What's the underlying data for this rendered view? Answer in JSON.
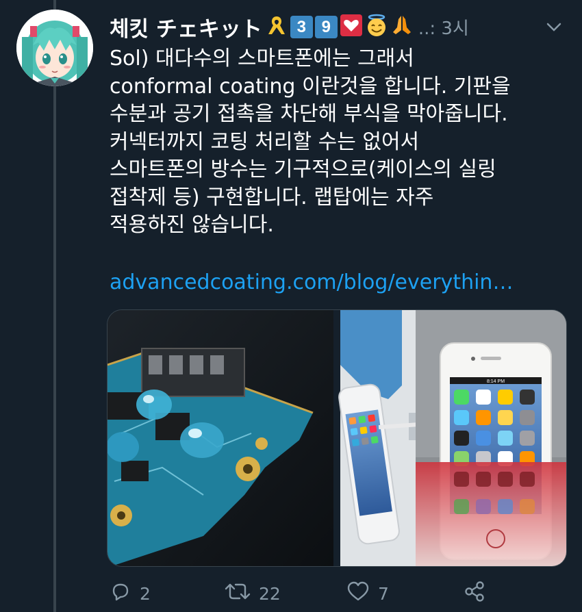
{
  "tweet": {
    "display_name": "체킷 チェキット",
    "badges": [
      "3",
      "9"
    ],
    "meta": "..: 3시",
    "body_lines": [
      "Sol) 대다수의 스마트폰에는 그래서",
      "conformal coating 이란것을 합니다. 기판을",
      "수분과 공기 접촉을 차단해 부식을 막아줍니다.",
      "커넥터까지 코팅 처리할 수는 없어서",
      "스마트폰의 방수는 기구적으로(케이스의 실링",
      "접착제 등) 구현합니다. 랩탑에는 자주",
      "적용하진 않습니다."
    ],
    "link": "advancedcoating.com/blog/everythin…"
  },
  "phone": {
    "time": "8:14 PM"
  },
  "actions": {
    "reply_count": "2",
    "retweet_count": "22",
    "like_count": "7"
  },
  "icons": [
    "reply-icon",
    "retweet-icon",
    "like-icon",
    "share-icon",
    "chevron-down-icon",
    "ribbon-icon",
    "heart-icon",
    "halo-smile-icon",
    "praying-hands-icon"
  ],
  "colors": {
    "background": "#15202b",
    "text": "#ffffff",
    "muted": "#8899a6",
    "link": "#1da1f2",
    "divider": "#38444d"
  }
}
